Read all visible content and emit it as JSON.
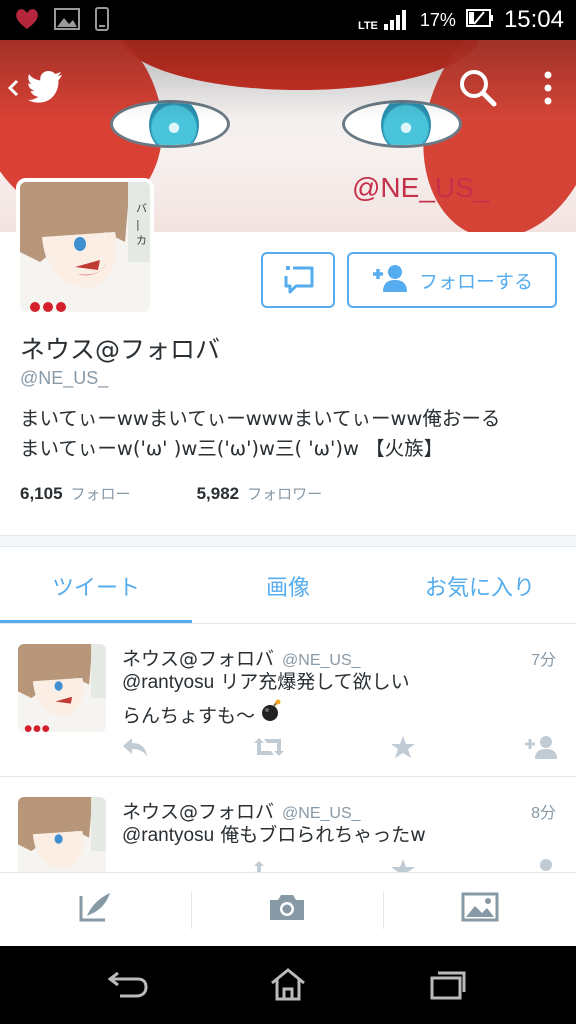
{
  "status_bar": {
    "network": "LTE",
    "battery": "17%",
    "time": "15:04"
  },
  "banner": {
    "handle_text": "@NE_US_"
  },
  "header_icons": {
    "back": "back-chevron-icon",
    "logo": "twitter-bird-icon",
    "search": "search-icon",
    "more": "more-vertical-icon"
  },
  "profile": {
    "display_name": "ネウス@フォロバ",
    "handle": "@NE_US_",
    "bio": "まいてぃーwwまいてぃーwwwまいてぃーww俺おーる\nまいてぃーw('ω' )w三('ω')w三( 'ω')w 【火族】",
    "follow_label": "フォローする",
    "following_count": "6,105",
    "following_label": "フォロー",
    "followers_count": "5,982",
    "followers_label": "フォロワー",
    "avatar_text": "バーカ"
  },
  "tabs": [
    {
      "label": "ツイート",
      "active": true
    },
    {
      "label": "画像",
      "active": false
    },
    {
      "label": "お気に入り",
      "active": false
    }
  ],
  "tweets": [
    {
      "name": "ネウス@フォロバ",
      "handle": "@NE_US_",
      "time": "7分",
      "mention": "@rantyosu",
      "line1": "リア充爆発して欲しい",
      "line2": "らんちょすも〜"
    },
    {
      "name": "ネウス@フォロバ",
      "handle": "@NE_US_",
      "time": "8分",
      "mention": "@rantyosu",
      "line1": "俺もブロられちゃったw",
      "line2": ""
    }
  ],
  "colors": {
    "accent": "#55acee",
    "text": "#292f33",
    "muted": "#8899a6",
    "icon_muted": "#c1cbd4"
  }
}
